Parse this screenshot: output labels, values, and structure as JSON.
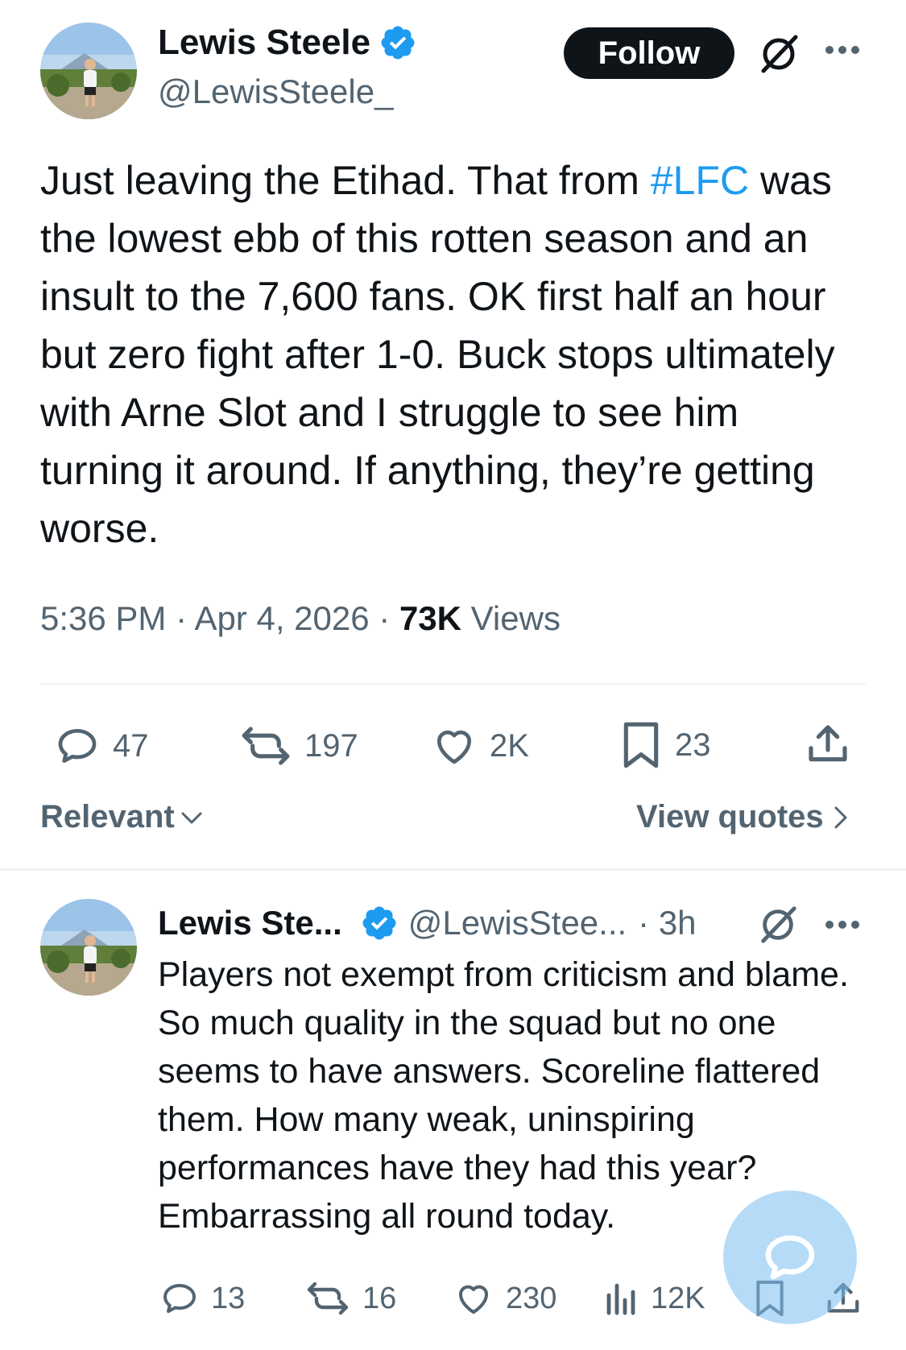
{
  "tweet": {
    "author_name": "Lewis Steele",
    "author_handle": "@LewisSteele_",
    "follow_label": "Follow",
    "text_before": "Just leaving the Etihad. That from ",
    "hashtag": "#LFC",
    "text_after": " was the lowest ebb of this rotten season and an insult to the 7,600 fans. OK first half an hour but zero fight after 1-0. Buck stops ultimately with Arne Slot and I struggle to see him turning it around. If anything, they’re getting worse.",
    "time": "5:36 PM",
    "date": "Apr 4, 2026",
    "views_count": "73K",
    "views_label": "Views",
    "replies": "47",
    "reposts": "197",
    "likes": "2K",
    "bookmarks": "23"
  },
  "filters": {
    "sort_label": "Relevant",
    "view_quotes_label": "View quotes"
  },
  "reply": {
    "author_name": "Lewis Ste...",
    "author_handle": "@LewisStee...",
    "time": "· 3h",
    "text": "Players not exempt from criticism and blame. So much quality in the squad but no one seems to have answers. Scoreline flattered them. How many weak, uninspiring performances have they had this year? Embarrassing all round today.",
    "replies": "13",
    "reposts": "16",
    "likes": "230",
    "views": "12K"
  },
  "colors": {
    "accent": "#1d9bf0",
    "text": "#0f1419",
    "muted": "#536471",
    "divider": "#eff3f4"
  },
  "icons": [
    "verified-badge-icon",
    "grok-icon",
    "more-icon",
    "reply-icon",
    "repost-icon",
    "like-icon",
    "bookmark-icon",
    "share-icon",
    "views-icon",
    "chevron-down-icon",
    "chevron-right-icon",
    "compose-icon"
  ]
}
